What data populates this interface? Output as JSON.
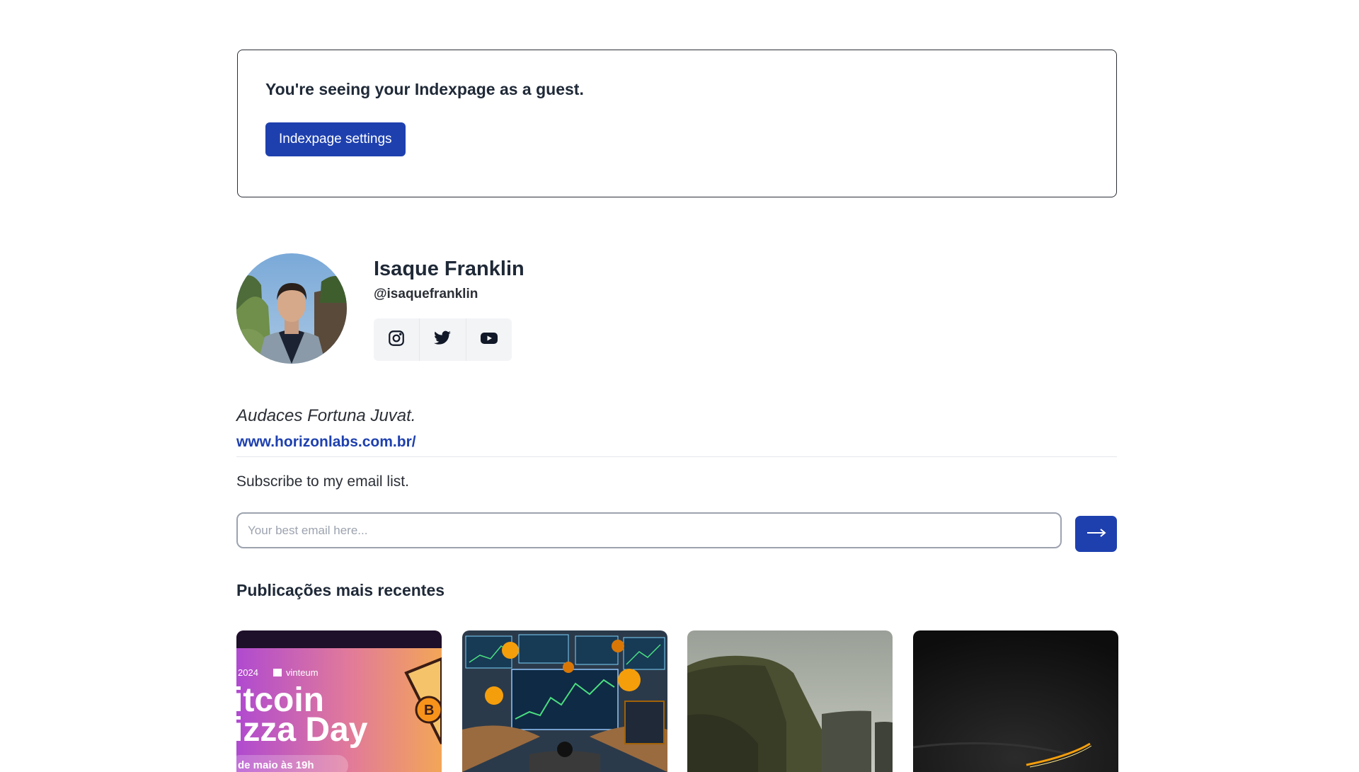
{
  "guest_notice": {
    "text": "You're seeing your Indexpage as a guest.",
    "settings_button": "Indexpage settings"
  },
  "profile": {
    "name": "Isaque Franklin",
    "handle": "@isaquefranklin",
    "social_icons": [
      "instagram-icon",
      "twitter-icon",
      "youtube-icon"
    ]
  },
  "bio": {
    "quote": "Audaces Fortuna Juvat.",
    "website": "www.horizonlabs.com.br/"
  },
  "subscribe": {
    "label": "Subscribe to my email list.",
    "placeholder": "Your best email here..."
  },
  "posts": {
    "heading": "Publicações mais recentes",
    "items": [
      {
        "thumbnail_text": {
          "year": "2024",
          "brand": "vinteum",
          "line1": "itcoin",
          "line2": "izza Day",
          "line3": "de maio às 19h"
        }
      },
      {},
      {},
      {}
    ]
  },
  "colors": {
    "primary": "#1e40af",
    "text_dark": "#1f2937",
    "border": "#2b2f36",
    "muted_bg": "#f3f4f6"
  }
}
